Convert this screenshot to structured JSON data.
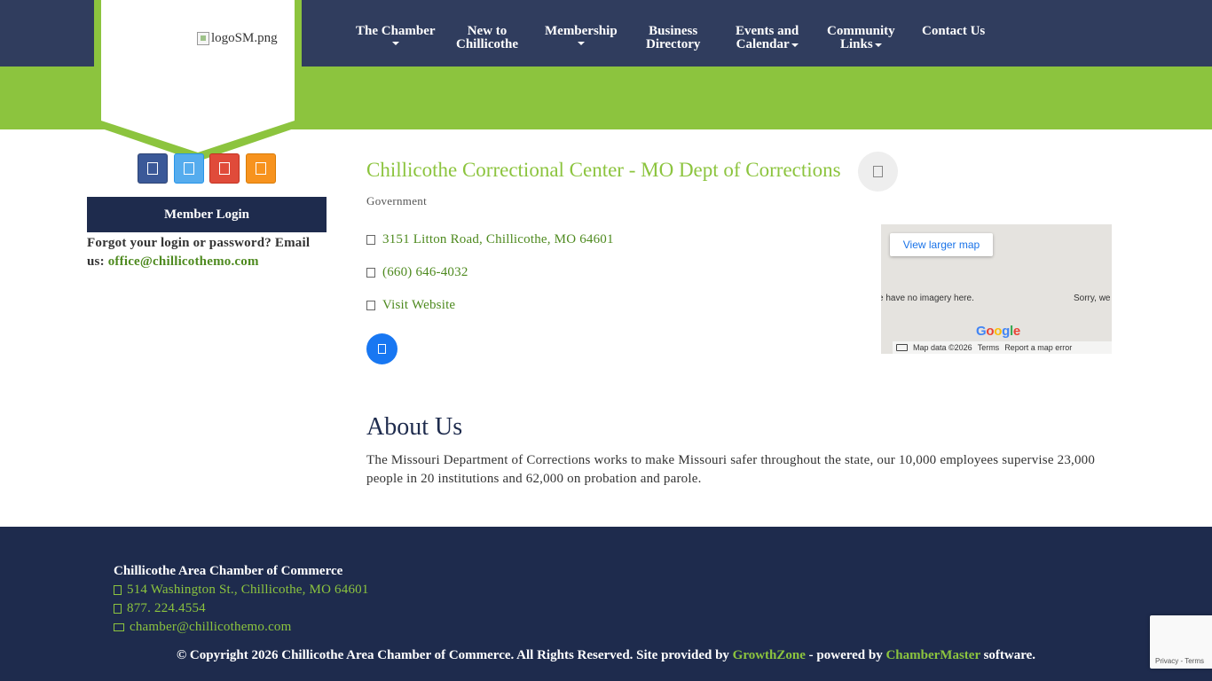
{
  "header": {
    "logo_alt": "logoSM.png",
    "nav": [
      {
        "line1": "The Chamber",
        "line2": "",
        "dropdown": true
      },
      {
        "line1": "New to",
        "line2": "Chillicothe",
        "dropdown": false
      },
      {
        "line1": "Membership",
        "line2": "",
        "dropdown": true
      },
      {
        "line1": "Business",
        "line2": "Directory",
        "dropdown": false
      },
      {
        "line1": "Events and",
        "line2": "Calendar",
        "dropdown": true
      },
      {
        "line1": "Community",
        "line2": "Links",
        "dropdown": true
      },
      {
        "line1": "Contact Us",
        "line2": "",
        "dropdown": false
      }
    ]
  },
  "sidebar": {
    "social": [
      "facebook-icon",
      "twitter-icon",
      "youtube-icon",
      "rss-icon"
    ],
    "member_login": "Member Login",
    "forgot_text": "Forgot your login or password?  Email us: ",
    "forgot_email": "office@chillicothemo.com"
  },
  "member": {
    "title": "Chillicothe Correctional Center - MO Dept of Corrections",
    "category": "Government",
    "address": "3151 Litton Road, Chillicothe, MO 64601",
    "phone": "(660) 646-4032",
    "website": "Visit Website"
  },
  "map": {
    "larger_map": "View larger map",
    "msg1": "e have no imagery here.",
    "msg2": "Sorry, we",
    "map_data": "Map data ©2026",
    "terms": "Terms",
    "report": "Report a map error"
  },
  "about": {
    "title": "About Us",
    "text": "The Missouri Department of Corrections works to make Missouri safer throughout the state, our 10,000 employees supervise 23,000 people in 20 institutions and 62,000 on probation and parole."
  },
  "footer": {
    "org_name": "Chillicothe Area Chamber of Commerce",
    "address": "514 Washington St., Chillicothe, MO 64601",
    "phone": "877. 224.4554",
    "email": "chamber@chillicothemo.com",
    "copyright_prefix": "© Copyright 2026 Chillicothe Area Chamber of Commerce. All Rights Reserved. Site provided by ",
    "growthzone": "GrowthZone",
    "powered_by": " - powered by ",
    "chambermaster": "ChamberMaster",
    "software": " software."
  },
  "recaptcha": {
    "privacy": "Privacy",
    "terms": "Terms"
  },
  "colors": {
    "navy": "#303d5e",
    "dark_navy": "#1e2b4d",
    "green": "#8cc43e",
    "link_green": "#4e8a1f"
  }
}
